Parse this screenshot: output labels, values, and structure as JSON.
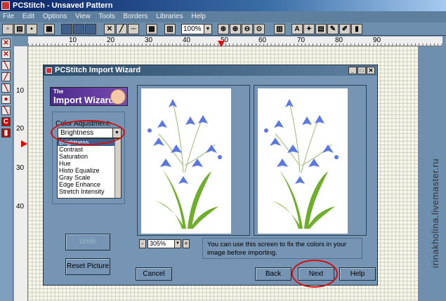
{
  "app": {
    "title": "PCStitch - Unsaved Pattern",
    "menu": [
      "File",
      "Edit",
      "Options",
      "View",
      "Tools",
      "Borders",
      "Libraries",
      "Help"
    ],
    "zoom": "100%"
  },
  "rulers": {
    "top": [
      "10",
      "20",
      "30",
      "40",
      "50",
      "60",
      "70",
      "80",
      "90"
    ],
    "left": [
      "10",
      "20",
      "30",
      "40"
    ]
  },
  "dialog": {
    "title": "PCStitch Import Wizard",
    "logo_small": "The",
    "logo_big": "Import Wizard",
    "color_adjustment_label": "Color Adjustment:",
    "selected_option": "Brightness",
    "options": [
      "Brightness",
      "Contrast",
      "Saturation",
      "Hue",
      "Histo Equalize",
      "Gray Scale",
      "Edge Enhance",
      "Stretch Intensity"
    ],
    "undo_label": "Undo",
    "reset_label": "Reset Picture",
    "zoom_minus": "-",
    "zoom_value": "305%",
    "zoom_plus": "+",
    "info_text": "You can use this screen to fix the colors in your image before importing.",
    "cancel_label": "Cancel",
    "back_label": "Back",
    "next_label": "Next",
    "help_label": "Help"
  },
  "watermark": "irinakholina.livemaster.ru",
  "colors": {
    "highlight_circle": "#d01010",
    "flower_blue": "#5a78e0",
    "leaf_green": "#6fae2a"
  }
}
